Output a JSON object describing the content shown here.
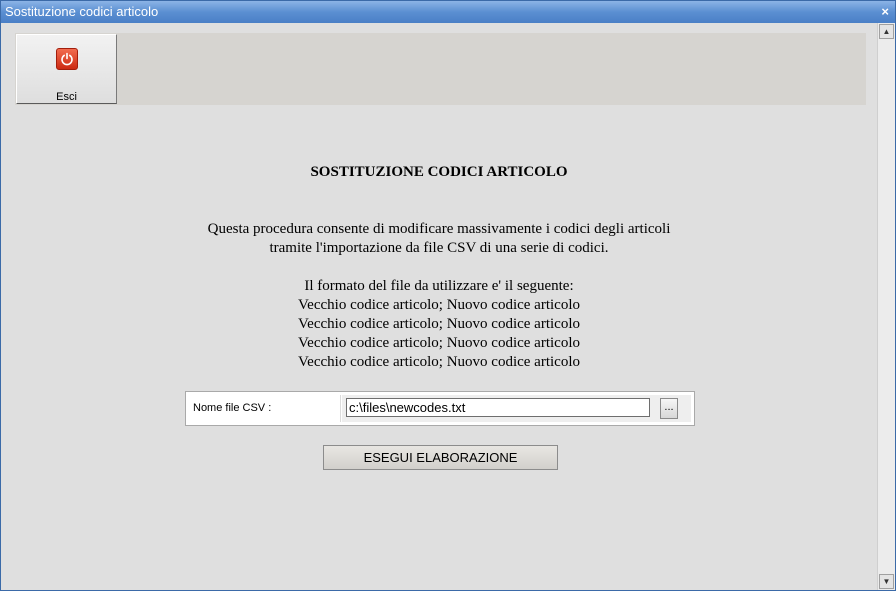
{
  "window": {
    "title": "Sostituzione codici articolo",
    "close_glyph": "×"
  },
  "toolbar": {
    "exit_label": "Esci",
    "exit_icon": "power-icon"
  },
  "main": {
    "heading": "SOSTITUZIONE CODICI ARTICOLO",
    "description_lines": [
      "Questa procedura consente di modificare massivamente i codici degli articoli",
      "tramite l'importazione da file CSV di una serie di codici."
    ],
    "format_intro": "Il formato del file da utilizzare e' il seguente:",
    "format_lines": [
      "Vecchio codice articolo; Nuovo codice articolo",
      "Vecchio codice articolo; Nuovo codice articolo",
      "Vecchio codice articolo; Nuovo codice articolo",
      "Vecchio codice articolo; Nuovo codice articolo"
    ]
  },
  "file_row": {
    "label": "Nome file CSV :",
    "value": "c:\\files\\newcodes.txt",
    "browse_label": "..."
  },
  "run_button_label": "ESEGUI ELABORAZIONE",
  "scrollbar": {
    "up_glyph": "▲",
    "down_glyph": "▼"
  },
  "colors": {
    "titlebar": "#4a7fc6",
    "background": "#dfdfdf",
    "exit_icon": "#e0442a"
  }
}
